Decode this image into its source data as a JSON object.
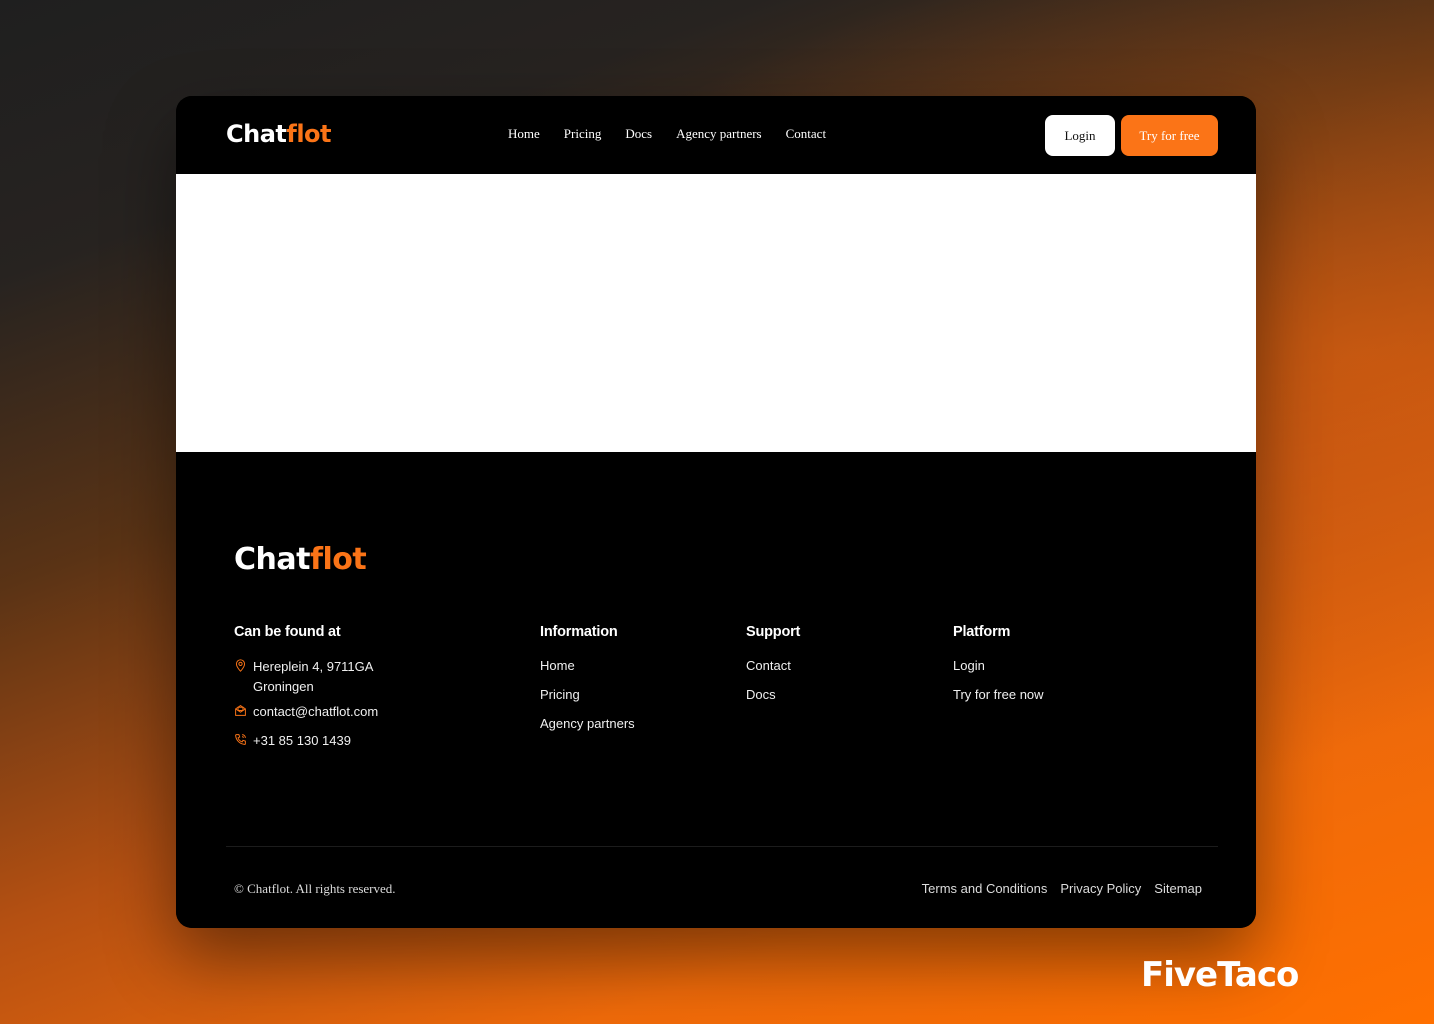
{
  "brand": {
    "name_white": "Chat",
    "name_orange": "flot",
    "accent_color": "#fb7417"
  },
  "nav": {
    "links": [
      "Home",
      "Pricing",
      "Docs",
      "Agency partners",
      "Contact"
    ],
    "login_label": "Login",
    "try_label": "Try for free"
  },
  "footer": {
    "contact": {
      "heading": "Can be found at",
      "address_line1": "Hereplein 4, 9711GA",
      "address_line2": "Groningen",
      "email": "contact@chatflot.com",
      "phone": "+31 85 130 1439",
      "icons": [
        "map-pin-icon",
        "mail-icon",
        "phone-icon"
      ]
    },
    "information": {
      "heading": "Information",
      "links": [
        "Home",
        "Pricing",
        "Agency partners"
      ]
    },
    "support": {
      "heading": "Support",
      "links": [
        "Contact",
        "Docs"
      ]
    },
    "platform": {
      "heading": "Platform",
      "links": [
        "Login",
        "Try for free now"
      ]
    },
    "copyright": "© Chatflot. All rights reserved.",
    "legal_links": [
      "Terms and Conditions",
      "Privacy Policy",
      "Sitemap"
    ]
  },
  "watermark": "FiveTaco"
}
